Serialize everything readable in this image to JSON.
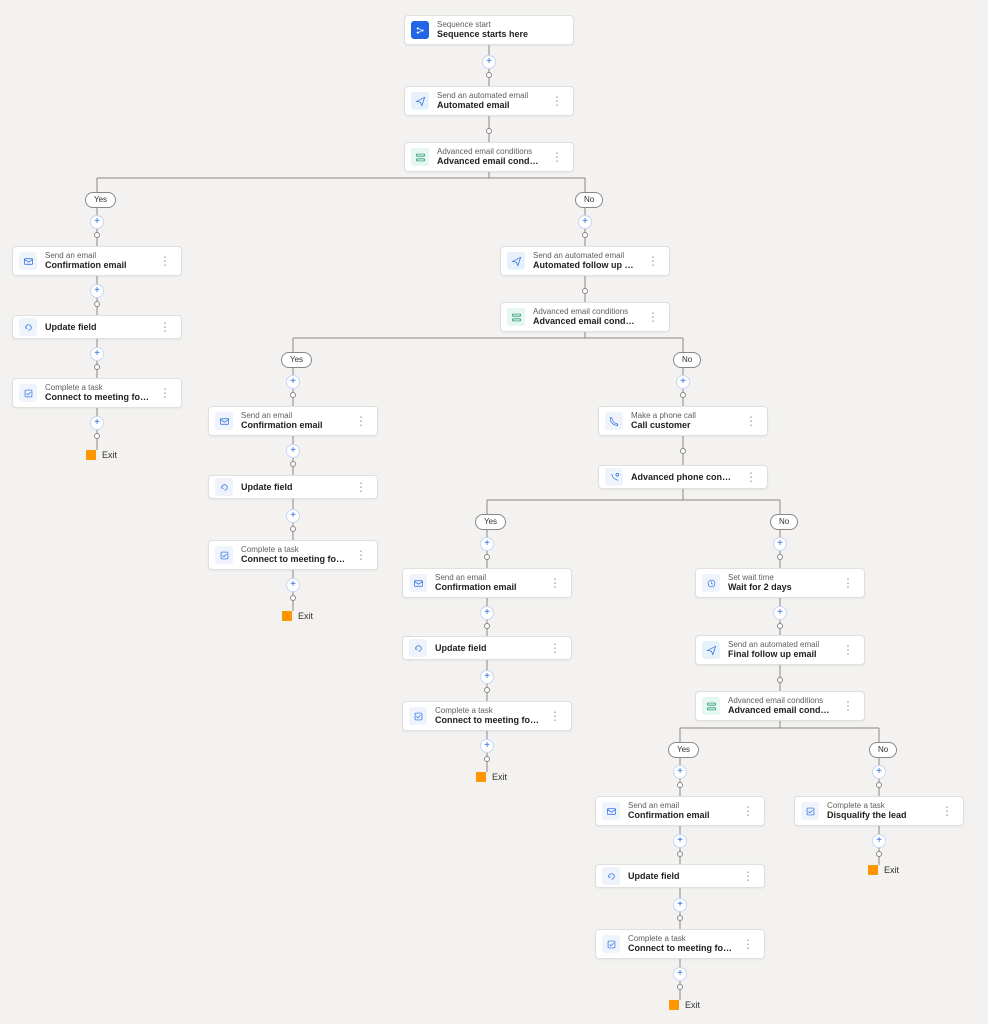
{
  "start": {
    "sub": "Sequence start",
    "main": "Sequence starts here"
  },
  "auto_email": {
    "sub": "Send an automated email",
    "main": "Automated email"
  },
  "adv_cond_1": {
    "sub": "Advanced email conditions",
    "main": "Advanced email conditions"
  },
  "labels": {
    "yes": "Yes",
    "no": "No",
    "exit": "Exit"
  },
  "conf_email": {
    "sub": "Send an email",
    "main": "Confirmation email"
  },
  "update_field": {
    "main": "Update field"
  },
  "complete_task_demo": {
    "sub": "Complete a task",
    "main": "Connect to meeting for product demo r..."
  },
  "auto_followup": {
    "sub": "Send an automated email",
    "main": "Automated follow up email"
  },
  "adv_cond_2": {
    "sub": "Advanced email conditions",
    "main": "Advanced email conditions"
  },
  "phone_call": {
    "sub": "Make a phone call",
    "main": "Call customer"
  },
  "adv_phone": {
    "main": "Advanced phone condition"
  },
  "wait": {
    "sub": "Set wait time",
    "main": "Wait for 2 days"
  },
  "final_followup": {
    "sub": "Send an automated email",
    "main": "Final follow up email"
  },
  "adv_cond_3": {
    "sub": "Advanced email conditions",
    "main": "Advanced email conditions"
  },
  "disqualify": {
    "sub": "Complete a task",
    "main": "Disqualify the lead"
  }
}
